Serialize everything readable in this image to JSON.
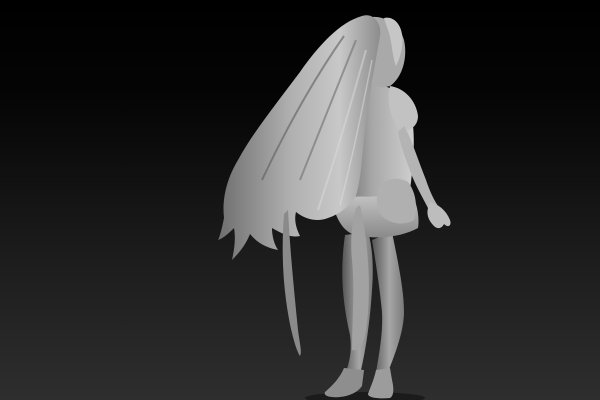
{
  "scene": {
    "subject": "sculpted-character-figure",
    "material": "clay-render",
    "colors": {
      "background_top": "#000000",
      "background_bottom": "#2e2e2e",
      "clay_light": "#d2d2d2",
      "clay_mid": "#9a9a9a",
      "clay_dark": "#4a4a4a"
    }
  }
}
